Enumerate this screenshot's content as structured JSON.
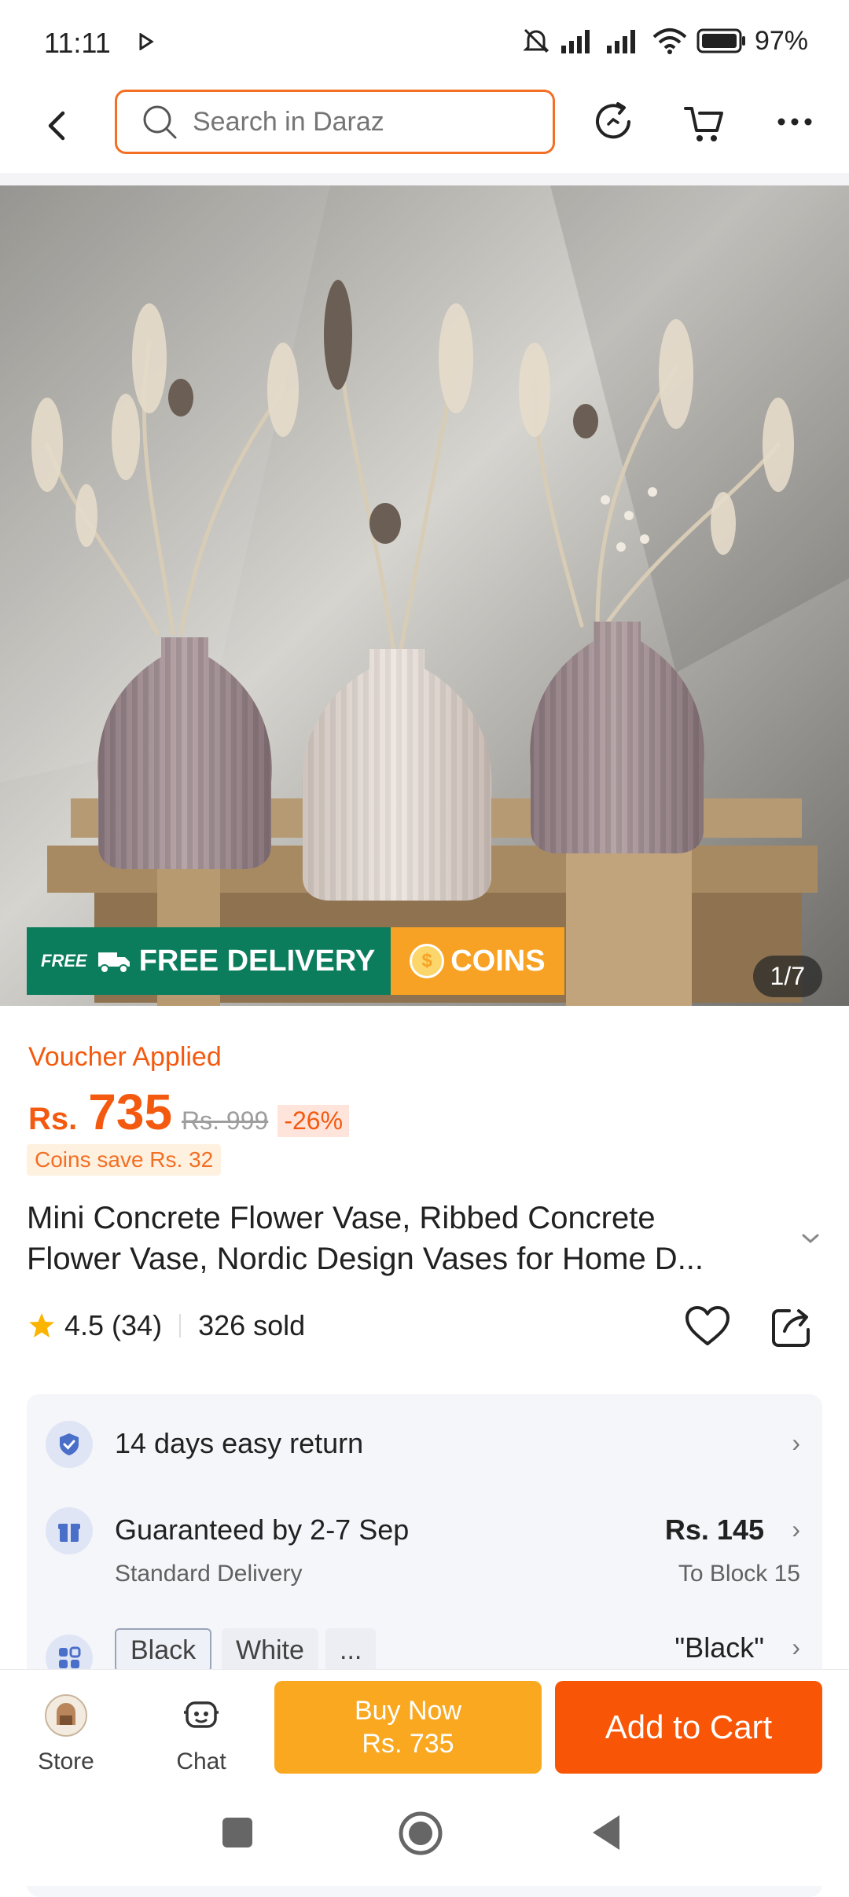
{
  "status": {
    "time": "11:11",
    "battery": "97%"
  },
  "search": {
    "placeholder": "Search in Daraz"
  },
  "hero": {
    "free_badge": "FREE",
    "free_delivery": "FREE DELIVERY",
    "coins": "COINS",
    "counter": "1/7"
  },
  "price": {
    "voucher": "Voucher Applied",
    "currency": "Rs.",
    "value": "735",
    "original": "Rs. 999",
    "discount": "-26%",
    "coins_save": "Coins save Rs. 32"
  },
  "product": {
    "title_line1": "Mini Concrete Flower Vase, Ribbed Concrete",
    "title_line2": "Flower Vase, Nordic Design Vases for Home D..."
  },
  "rating": {
    "score": "4.5",
    "count": "(34)",
    "sold": "326 sold"
  },
  "info": {
    "return": "14 days easy return",
    "delivery_title": "Guaranteed by 2-7 Sep",
    "delivery_sub": "Standard Delivery",
    "delivery_price": "Rs. 145",
    "delivery_to": "To Block 15",
    "variants": [
      "Black",
      "White",
      "..."
    ],
    "variant_selected": "\"Black\""
  },
  "bottom": {
    "store": "Store",
    "chat": "Chat",
    "buy_now_line1": "Buy Now",
    "buy_now_line2": "Rs. 735",
    "add_to_cart": "Add to Cart"
  },
  "colors": {
    "brand": "#f85606",
    "buy_now": "#f9a820",
    "delivery_green": "#0b7d5c"
  }
}
